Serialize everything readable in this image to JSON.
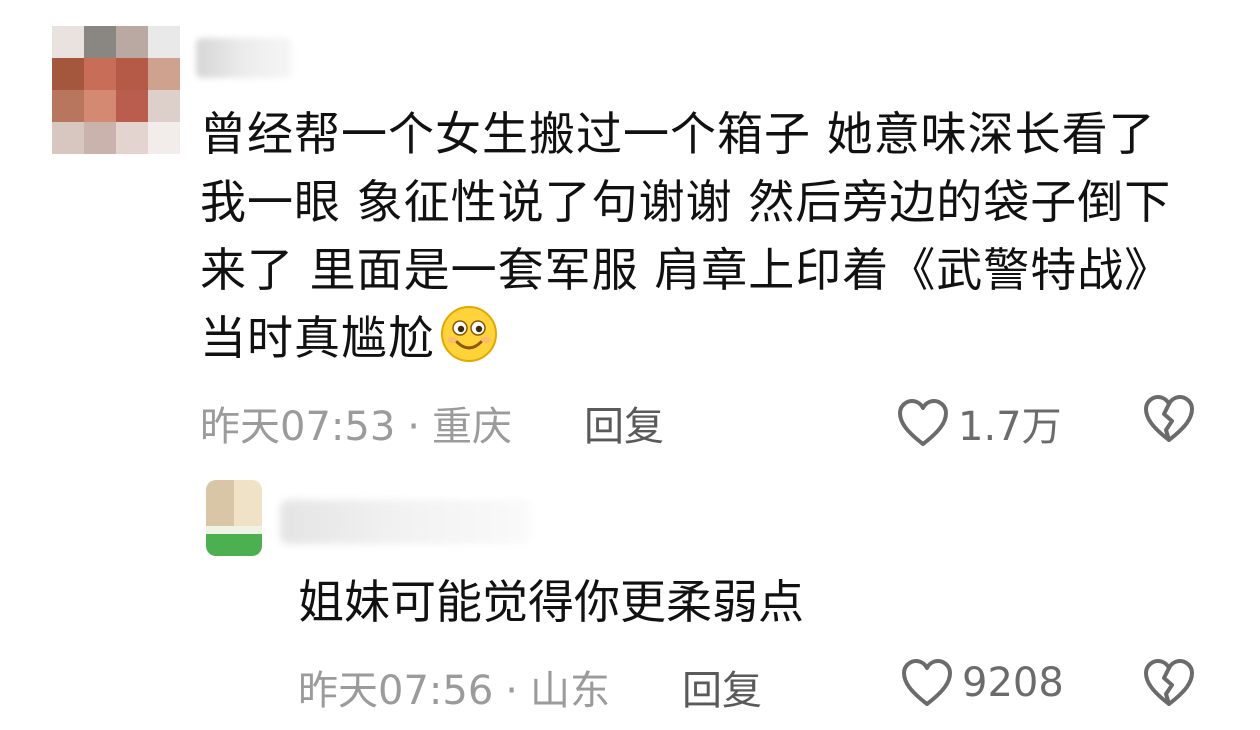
{
  "comment": {
    "text": "曾经帮一个女生搬过一个箱子 她意味深长看了我一眼 象征性说了句谢谢 然后旁边的袋子倒下来了 里面是一套军服 肩章上印着《武警特战》 当时真尴尬",
    "emoji": "smile-emoji",
    "time": "昨天07:53",
    "separator": "·",
    "location": "重庆",
    "reply_label": "回复",
    "likes": "1.7万"
  },
  "reply": {
    "text": "姐妹可能觉得你更柔弱点",
    "time": "昨天07:56",
    "separator": "·",
    "location": "山东",
    "reply_label": "回复",
    "likes": "9208"
  },
  "colors": {
    "meta": "#9b9b9b",
    "reply_label": "#5a5a5a",
    "icon": "#6b6b6b",
    "avatar_badge": "#4caf50"
  }
}
